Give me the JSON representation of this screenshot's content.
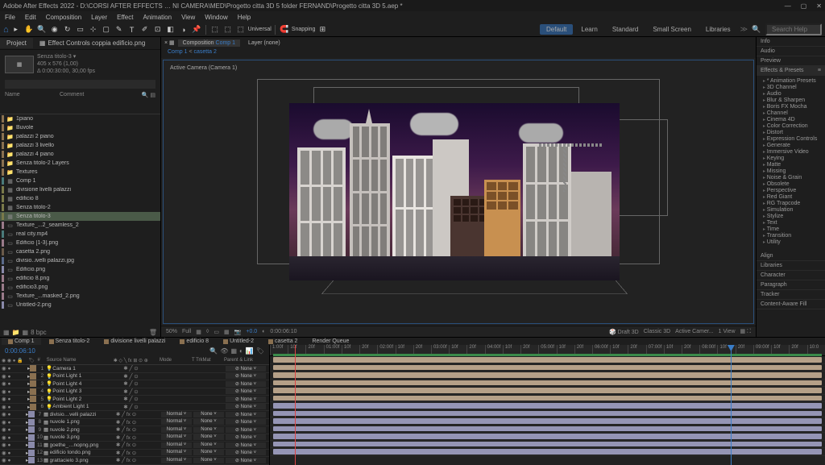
{
  "title_bar": {
    "title": "Adobe After Effects 2022 - D:\\CORSI AFTER EFFECTS … NI CAMERA\\MED\\Progetto citta 3D 5 folder FERNAND\\Progetto citta 3D 5.aep *"
  },
  "menu": [
    "File",
    "Edit",
    "Composition",
    "Layer",
    "Effect",
    "Animation",
    "View",
    "Window",
    "Help"
  ],
  "toolbar": {
    "snapping": "Snapping",
    "universal": "Universal",
    "workspaces": [
      "Default",
      "Learn",
      "Standard",
      "Small Screen",
      "Libraries"
    ],
    "active_ws": "Default",
    "search_ph": "Search Help"
  },
  "project": {
    "tab_label": "Project",
    "effects_tab": "Effect Controls coppia edificio.png",
    "asset_name": "Senza titolo-3 ▾",
    "asset_dims": "405 x 576 (1,00)",
    "asset_dur": "Δ 0:00:30:00, 30,00 fps",
    "search_ph": "",
    "cols": {
      "name": "Name",
      "comment": "Comment"
    },
    "items": [
      {
        "name": "1piano",
        "c": "c-gold",
        "icon": "📁"
      },
      {
        "name": "Buvole",
        "c": "c-gold",
        "icon": "📁"
      },
      {
        "name": "palazzi 2 piano",
        "c": "c-gold",
        "icon": "📁"
      },
      {
        "name": "palazzi 3 livello",
        "c": "c-gold",
        "icon": "📁"
      },
      {
        "name": "palazzi 4 piano",
        "c": "c-gold",
        "icon": "📁"
      },
      {
        "name": "Senza titolo-2 Layers",
        "c": "c-gold",
        "icon": "📁"
      },
      {
        "name": "Textures",
        "c": "c-gold",
        "icon": "📁"
      },
      {
        "name": "Comp 1",
        "c": "c-teal",
        "icon": "▦"
      },
      {
        "name": "divisione livelli palazzi",
        "c": "c-olive",
        "icon": "▦"
      },
      {
        "name": "edificio 8",
        "c": "c-olive",
        "icon": "▦"
      },
      {
        "name": "Senza titolo-2",
        "c": "c-olive",
        "icon": "▦"
      },
      {
        "name": "Senza titolo-3",
        "c": "c-olive",
        "icon": "▦",
        "sel": true
      },
      {
        "name": "Texture_...2_seamless_2",
        "c": "c-pink",
        "icon": "▭"
      },
      {
        "name": "real city.mp4",
        "c": "c-teal",
        "icon": "▭"
      },
      {
        "name": "Edificio [1-3].png",
        "c": "c-pink",
        "icon": "▭"
      },
      {
        "name": "casetta 2.png",
        "c": "c-brown",
        "icon": "▭"
      },
      {
        "name": "divisio..ivelli palazzi.jpg",
        "c": "c-blue",
        "icon": "▭"
      },
      {
        "name": "Edificio.png",
        "c": "c-lav",
        "icon": "▭"
      },
      {
        "name": "edificio 8.png",
        "c": "c-pink",
        "icon": "▭"
      },
      {
        "name": "edificio3.png",
        "c": "c-pink",
        "icon": "▭"
      },
      {
        "name": "Texture_...masked_2.png",
        "c": "c-pink",
        "icon": "▭"
      },
      {
        "name": "Untitled-2.png",
        "c": "c-lav",
        "icon": "▭"
      }
    ],
    "footer_bits": "8 bpc"
  },
  "comp_panel": {
    "tab": "Composition",
    "active": "Comp 1",
    "other": "Layer (none)",
    "crumb_a": "Comp 1",
    "crumb_b": "casetta 2",
    "camera_label": "Active Camera (Camera 1)"
  },
  "viewer_footer": {
    "zoom": "50%",
    "res": "Full",
    "time": "0:00:06:10",
    "draft3d": "Draft 3D",
    "renderer": "Classic 3D",
    "view": "Active Camer...",
    "viewcount": "1 View"
  },
  "right": {
    "sections_top": [
      "Info",
      "Audio",
      "Preview"
    ],
    "ep_title": "Effects & Presets",
    "ep_items": [
      "* Animation Presets",
      "3D Channel",
      "Audio",
      "Blur & Sharpen",
      "Boris FX Mocha",
      "Channel",
      "Cinema 4D",
      "Color Correction",
      "Distort",
      "Expression Controls",
      "Generate",
      "Immersive Video",
      "Keying",
      "Matte",
      "Missing",
      "Noise & Grain",
      "Obsolete",
      "Perspective",
      "Red Giant",
      "RG Trapcode",
      "Simulation",
      "Stylize",
      "Text",
      "Time",
      "Transition",
      "Utility"
    ],
    "sections_bottom": [
      "Align",
      "Libraries",
      "Character",
      "Paragraph",
      "Tracker",
      "Content-Aware Fill"
    ]
  },
  "timeline": {
    "time": "0:00:06:10",
    "tabs": [
      {
        "label": "Comp 1",
        "active": true
      },
      {
        "label": "Senza titolo-2"
      },
      {
        "label": "divisione livelli palazzi"
      },
      {
        "label": "edificio 8"
      },
      {
        "label": "Untitled-2"
      },
      {
        "label": "casetta 2"
      },
      {
        "label": "Render Queue",
        "plain": true
      }
    ],
    "cols": {
      "src": "Source Name",
      "mode": "Mode",
      "trk": "T  TrkMat",
      "parent": "Parent & Link"
    },
    "ruler": [
      "1:00f",
      "10f",
      "20f",
      "01:00f",
      "10f",
      "20f",
      "02:00f",
      "10f",
      "20f",
      "03:00f",
      "10f",
      "20f",
      "04:00f",
      "10f",
      "20f",
      "05:00f",
      "10f",
      "20f",
      "06:00f",
      "10f",
      "20f",
      "07:00f",
      "10f",
      "20f",
      "08:00f",
      "10f",
      "20f",
      "09:00f",
      "10f",
      "20f",
      "10:0"
    ],
    "layers": [
      {
        "n": "1",
        "name": "Camera 1",
        "c": "c-gold",
        "bar": "bar-tan",
        "modes": false
      },
      {
        "n": "2",
        "name": "Point Light 1",
        "c": "c-gold",
        "bar": "bar-tan",
        "modes": false
      },
      {
        "n": "3",
        "name": "Point Light 4",
        "c": "c-gold",
        "bar": "bar-tan",
        "modes": false
      },
      {
        "n": "4",
        "name": "Point Light 3",
        "c": "c-gold",
        "bar": "bar-tan",
        "modes": false
      },
      {
        "n": "5",
        "name": "Point Light 2",
        "c": "c-gold",
        "bar": "bar-tan",
        "modes": false
      },
      {
        "n": "6",
        "name": "Ambient Light 1",
        "c": "c-gold",
        "bar": "bar-tan",
        "modes": false
      },
      {
        "n": "7",
        "name": "divisio…velli palazzi",
        "c": "c-lav",
        "bar": "bar-lav",
        "modes": true
      },
      {
        "n": "8",
        "name": "nuvole 1.png",
        "c": "c-lav",
        "bar": "bar-lav",
        "modes": true
      },
      {
        "n": "9",
        "name": "nuvole 2.png",
        "c": "c-lav",
        "bar": "bar-lav",
        "modes": true
      },
      {
        "n": "10",
        "name": "nuvole 3.png",
        "c": "c-lav",
        "bar": "bar-lav",
        "modes": true
      },
      {
        "n": "11",
        "name": "goethe_…nopng.png",
        "c": "c-lav",
        "bar": "bar-lav",
        "modes": true
      },
      {
        "n": "12",
        "name": "edificio tondo.png",
        "c": "c-lav",
        "bar": "bar-lav",
        "modes": true
      },
      {
        "n": "13",
        "name": "grattacielo 3.png",
        "c": "c-lav",
        "bar": "bar-lav",
        "modes": true
      }
    ],
    "mode_label": "Normal",
    "none_label": "None"
  }
}
